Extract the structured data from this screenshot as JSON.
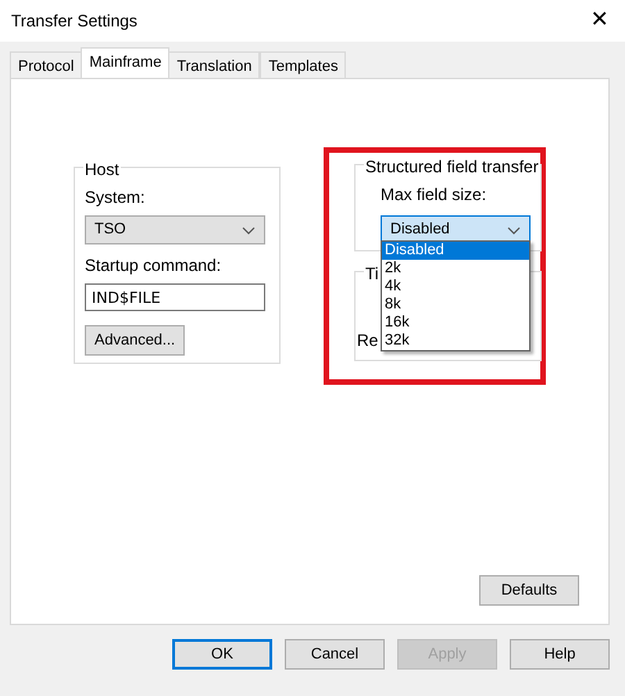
{
  "window": {
    "title": "Transfer Settings",
    "close": "✕"
  },
  "tabs": [
    {
      "label": "Protocol",
      "selected": false
    },
    {
      "label": "Mainframe",
      "selected": true
    },
    {
      "label": "Translation",
      "selected": false
    },
    {
      "label": "Templates",
      "selected": false
    }
  ],
  "host": {
    "title": "Host",
    "system_label": "System:",
    "system_value": "TSO",
    "startup_label": "Startup command:",
    "startup_value": "IND$FILE",
    "advanced": "Advanced..."
  },
  "structured": {
    "title": "Structured field transfer",
    "max_label": "Max field size:",
    "max_value": "Disabled",
    "expanded": true,
    "options": [
      {
        "label": "Disabled",
        "selected": true
      },
      {
        "label": "2k",
        "selected": false
      },
      {
        "label": "4k",
        "selected": false
      },
      {
        "label": "8k",
        "selected": false
      },
      {
        "label": "16k",
        "selected": false
      },
      {
        "label": "32k",
        "selected": false
      }
    ]
  },
  "hidden_group": {
    "title": "Ti",
    "label": "Re"
  },
  "defaults": {
    "label": "Defaults"
  },
  "buttons": [
    {
      "label": "OK",
      "default": true,
      "disabled": false
    },
    {
      "label": "Cancel",
      "default": false,
      "disabled": false
    },
    {
      "label": "Apply",
      "default": false,
      "disabled": true
    },
    {
      "label": "Help",
      "default": false,
      "disabled": false
    }
  ]
}
